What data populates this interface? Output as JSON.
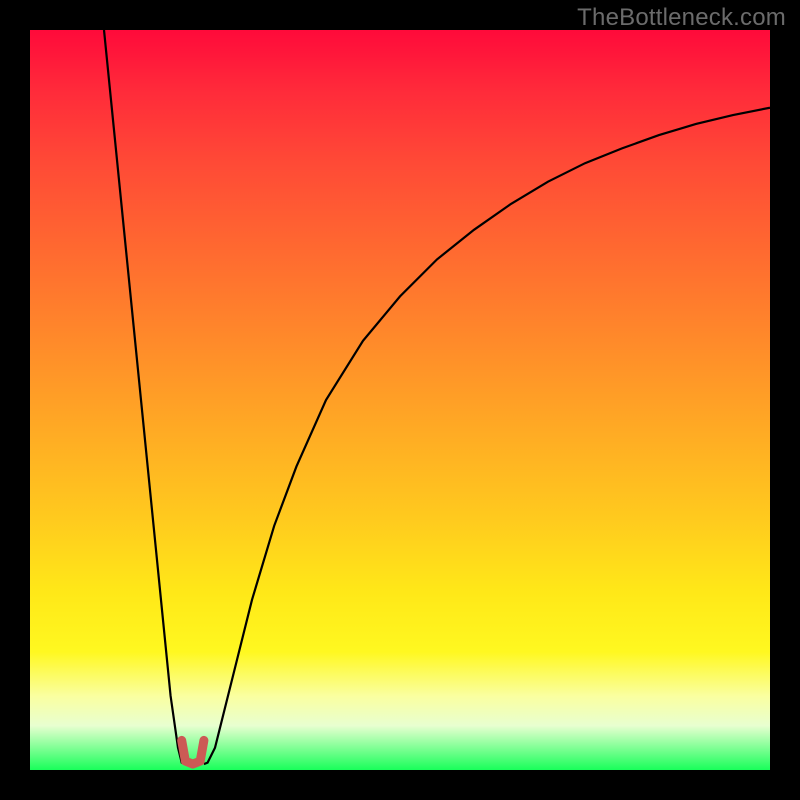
{
  "watermark": {
    "text": "TheBottleneck.com"
  },
  "colors": {
    "frame": "#000000",
    "curve": "#000000",
    "marker": "#cc5a55",
    "gradient_top": "#ff0a3a",
    "gradient_bottom": "#19ff5a"
  },
  "chart_data": {
    "type": "line",
    "title": "",
    "xlabel": "",
    "ylabel": "",
    "xlim": [
      0,
      100
    ],
    "ylim": [
      0,
      100
    ],
    "note": "x and y are percentages of the plot area (origin bottom-left). Values estimated from pixels; no axis ticks shown.",
    "series": [
      {
        "name": "left-branch",
        "x": [
          10,
          11,
          12,
          13,
          14,
          15,
          16,
          17,
          18,
          19,
          20,
          20.5,
          21.5
        ],
        "y": [
          100,
          90,
          80,
          70,
          60,
          50,
          40,
          30,
          20,
          10,
          3,
          1,
          0.8
        ]
      },
      {
        "name": "right-branch",
        "x": [
          23.5,
          24,
          25,
          26,
          28,
          30,
          33,
          36,
          40,
          45,
          50,
          55,
          60,
          65,
          70,
          75,
          80,
          85,
          90,
          95,
          100
        ],
        "y": [
          0.8,
          1,
          3,
          7,
          15,
          23,
          33,
          41,
          50,
          58,
          64,
          69,
          73,
          76.5,
          79.5,
          82,
          84,
          85.8,
          87.3,
          88.5,
          89.5
        ]
      },
      {
        "name": "valley-marker",
        "x": [
          20.5,
          21,
          22,
          23,
          23.5
        ],
        "y": [
          4,
          1.2,
          0.8,
          1.2,
          4
        ]
      }
    ],
    "valley_x": 22
  }
}
